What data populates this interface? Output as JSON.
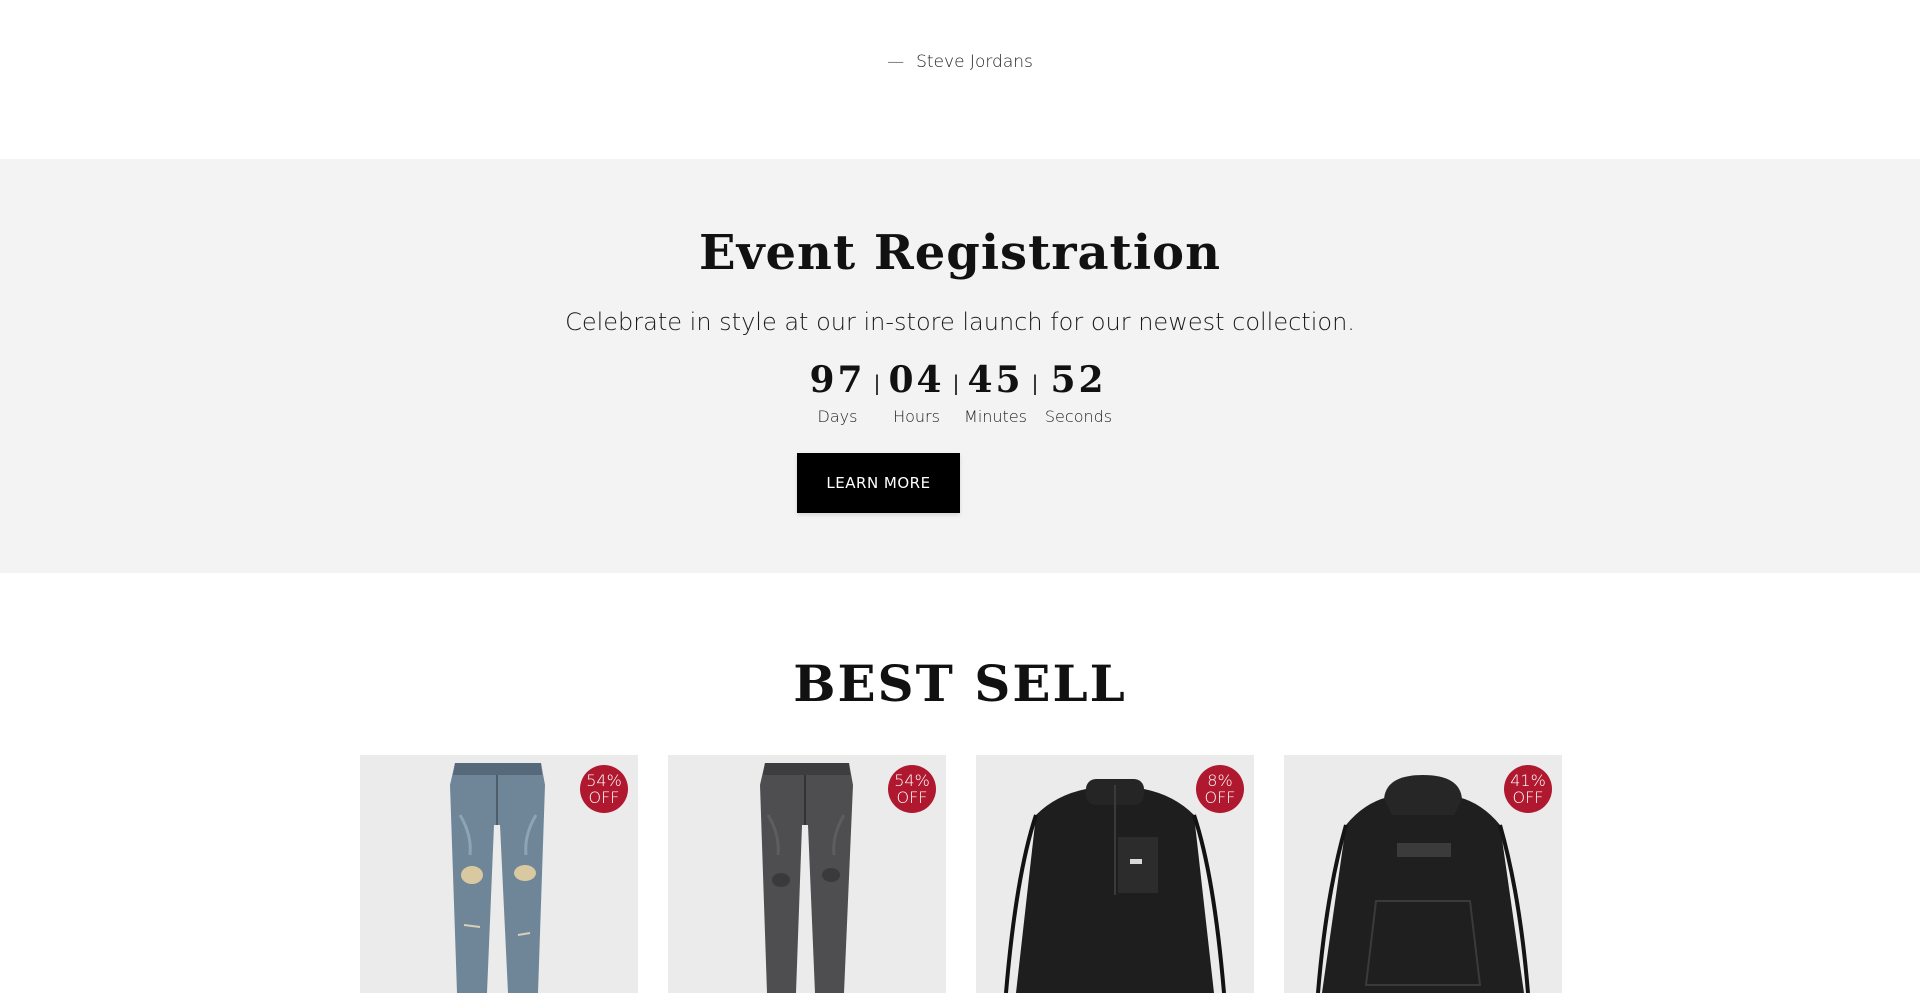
{
  "testimonial": {
    "dash": "—",
    "author": "Steve Jordans"
  },
  "event": {
    "title": "Event Registration",
    "subtitle": "Celebrate in style at our in-store launch for our newest collection.",
    "countdown": [
      {
        "value": "97",
        "label": "Days"
      },
      {
        "value": "04",
        "label": "Hours"
      },
      {
        "value": "45",
        "label": "Minutes"
      },
      {
        "value": "52",
        "label": "Seconds"
      }
    ],
    "separator": "|",
    "button_label": "LEARN MORE"
  },
  "best_sell": {
    "title": "BEST SELL",
    "products": [
      {
        "badge_percent": "54%",
        "badge_off": "OFF",
        "image": "light-wash-ripped-jeans"
      },
      {
        "badge_percent": "54%",
        "badge_off": "OFF",
        "image": "grey-ripped-jeans"
      },
      {
        "badge_percent": "8%",
        "badge_off": "OFF",
        "image": "black-fleece-quarter-zip"
      },
      {
        "badge_percent": "41%",
        "badge_off": "OFF",
        "image": "black-hoodie"
      }
    ]
  },
  "colors": {
    "section_bg": "#f3f3f3",
    "badge": "#b0182f",
    "button": "#000000",
    "card_bg": "#ebebeb"
  }
}
